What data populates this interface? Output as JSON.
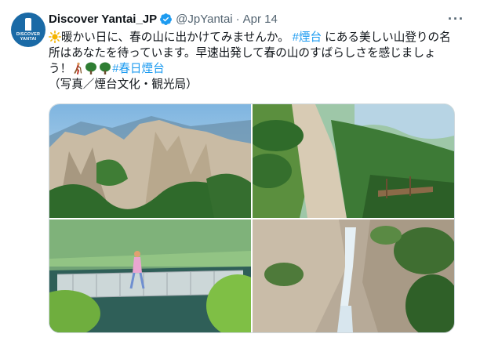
{
  "tweet": {
    "avatar_text": "DISCOVER YANTAI",
    "display_name": "Discover Yantai_JP",
    "handle": "@JpYantai",
    "separator": "·",
    "date": "Apr 14",
    "more_label": "···",
    "text_part1": "暖かい日に、春の山に出かけてみませんか。",
    "hashtag1": "#煙台",
    "text_part2": "にある美しい山登りの名所はあなたを待っています。早速出発して春の山のすばらしさを感じましょう！",
    "hashtag2": "#春日煙台",
    "credit": "（写真／煙台文化・観光局）"
  },
  "media": {
    "photo1_alt": "rocky mountain peaks",
    "photo2_alt": "pine trees mountain path",
    "photo3_alt": "person on rope bridge",
    "photo4_alt": "waterfall in gorge"
  },
  "icons": [
    "verified-badge-icon",
    "sun-icon",
    "hiker-icon",
    "tree-icon",
    "more-icon"
  ],
  "colors": {
    "link": "#1d9bf0",
    "verified": "#1d9bf0",
    "muted": "#536471"
  }
}
